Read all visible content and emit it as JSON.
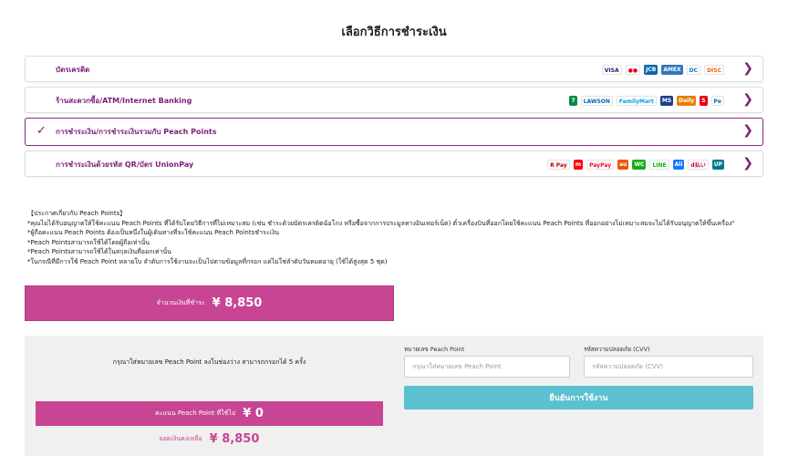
{
  "page": {
    "title": "เลือกวิธีการชำระเงิน"
  },
  "methods": [
    {
      "label": "บัตรเครดิต",
      "selected": false,
      "logos": [
        {
          "name": "visa-logo",
          "text": "VISA",
          "color": "#1a1f71",
          "bg": "#ffffff"
        },
        {
          "name": "mastercard-logo",
          "text": "●●",
          "color": "#eb001b",
          "bg": "#ffffff"
        },
        {
          "name": "jcb-logo",
          "text": "JCB",
          "color": "#ffffff",
          "bg": "#0b6aa8"
        },
        {
          "name": "amex-logo",
          "text": "AMEX",
          "color": "#ffffff",
          "bg": "#2e77bb"
        },
        {
          "name": "diners-logo",
          "text": "DC",
          "color": "#0079be",
          "bg": "#ffffff"
        },
        {
          "name": "discover-logo",
          "text": "DISC",
          "color": "#ff6000",
          "bg": "#ffffff"
        }
      ]
    },
    {
      "label": "ร้านสะดวกซื้อ/ATM/Internet Banking",
      "selected": false,
      "logos": [
        {
          "name": "seven-eleven-logo",
          "text": "7",
          "color": "#ffffff",
          "bg": "#008a45"
        },
        {
          "name": "lawson-logo",
          "text": "LAWSON",
          "color": "#0068b7",
          "bg": "#ffffff"
        },
        {
          "name": "familymart-logo",
          "text": "FamilyMart",
          "color": "#00a0e9",
          "bg": "#ffffff"
        },
        {
          "name": "ministop-logo",
          "text": "MS",
          "color": "#ffffff",
          "bg": "#1d3e8a"
        },
        {
          "name": "daily-yamazaki-logo",
          "text": "Daily",
          "color": "#ffffff",
          "bg": "#e67e00"
        },
        {
          "name": "seicomart-logo",
          "text": "S",
          "color": "#ffffff",
          "bg": "#e60012"
        },
        {
          "name": "payeasy-logo",
          "text": "Pe",
          "color": "#0068b7",
          "bg": "#ffffff"
        }
      ]
    },
    {
      "label": "การชำระเงิน/การชำระเงินรวมกับ Peach Points",
      "selected": true,
      "logos": []
    },
    {
      "label": "การชำระเงินด้วยรหัส QR/บัตร UnionPay",
      "selected": false,
      "logos": [
        {
          "name": "rpay-logo",
          "text": "R Pay",
          "color": "#bf0000",
          "bg": "#ffffff"
        },
        {
          "name": "merpay-logo",
          "text": "m",
          "color": "#ffffff",
          "bg": "#ff0211"
        },
        {
          "name": "paypay-logo",
          "text": "PayPay",
          "color": "#ff0033",
          "bg": "#ffffff"
        },
        {
          "name": "aupay-logo",
          "text": "au",
          "color": "#ffffff",
          "bg": "#eb5505"
        },
        {
          "name": "wechat-logo",
          "text": "WC",
          "color": "#ffffff",
          "bg": "#1aad19"
        },
        {
          "name": "linepay-logo",
          "text": "LINE",
          "color": "#00b900",
          "bg": "#ffffff"
        },
        {
          "name": "alipay-logo",
          "text": "Ali",
          "color": "#ffffff",
          "bg": "#1677ff"
        },
        {
          "name": "dbarai-logo",
          "text": "d払い",
          "color": "#cc0033",
          "bg": "#ffffff"
        },
        {
          "name": "unionpay-logo",
          "text": "UP",
          "color": "#ffffff",
          "bg": "#01798a"
        }
      ]
    }
  ],
  "notice": [
    "【ประกาศเกี่ยวกับ Peach Points】",
    "*คุณไม่ได้รับอนุญาตให้ใช้คะแนน Peach Points ที่ได้รับโดยวิธีการที่ไม่เหมาะสม (เช่น ชำระด้วยบัตรเครดิตฉ้อโกง หรือซื้อจากการประมูลทางอินเทอร์เน็ต) ตั๋วเครื่องบินที่ออกโดยใช้คะแนน Peach Points ที่ออกอย่างไม่เหมาะสมจะไม่ได้รับอนุญาตให้ขึ้นเครื่อง\"",
    "*ผู้ถือคะแนน Peach Points ต้องเป็นหนึ่งในผู้เดินทางที่จะใช้คะแนน Peach Pointsชำระเงิน",
    "*Peach Pointsสามารถใช้ได้โดยผู้ถือเท่านั้น",
    "*Peach Pointsสามารถใช้ได้ในสกุลเงินที่ออกเท่านั้น",
    "*ในกรณีที่มีการใช้ Peach Point หลายใบ ลำดับการใช้งานจะเป็นไปตามข้อมูลที่กรอก แต่ไม่ใช่ลำดับวันหมดอายุ (ใช้ได้สูงสุด 5 ชุด)"
  ],
  "amount": {
    "label": "จำนวนเงินที่ชำระ",
    "value": "¥ 8,850"
  },
  "points": {
    "instruction": "กรุณาใส่หมายเลข Peach Point ลงในช่องว่าง สามารถกรอกได้ 5 ครั้ง",
    "used_label": "คะแนน Peach Point ที่ใช้ไป",
    "used_value": "¥ 0",
    "remain_label": "ยอดเงินคงเหลือ",
    "remain_value": "¥ 8,850",
    "number_label": "หมายเลข Peach Point",
    "number_placeholder": "กรุณาใส่หมายเลข Peach Point",
    "cvv_label": "รหัสความปลอดภัย (CVV)",
    "cvv_placeholder": "รหัสความปลอดภัย (CVV)",
    "confirm_label": "ยืนยันการใช้งาน"
  },
  "icons": {
    "check": "✓",
    "chevron": "❯"
  },
  "colors": {
    "brand": "#7b1f76",
    "pink": "#c74593",
    "confirm": "#5bc0d0"
  }
}
